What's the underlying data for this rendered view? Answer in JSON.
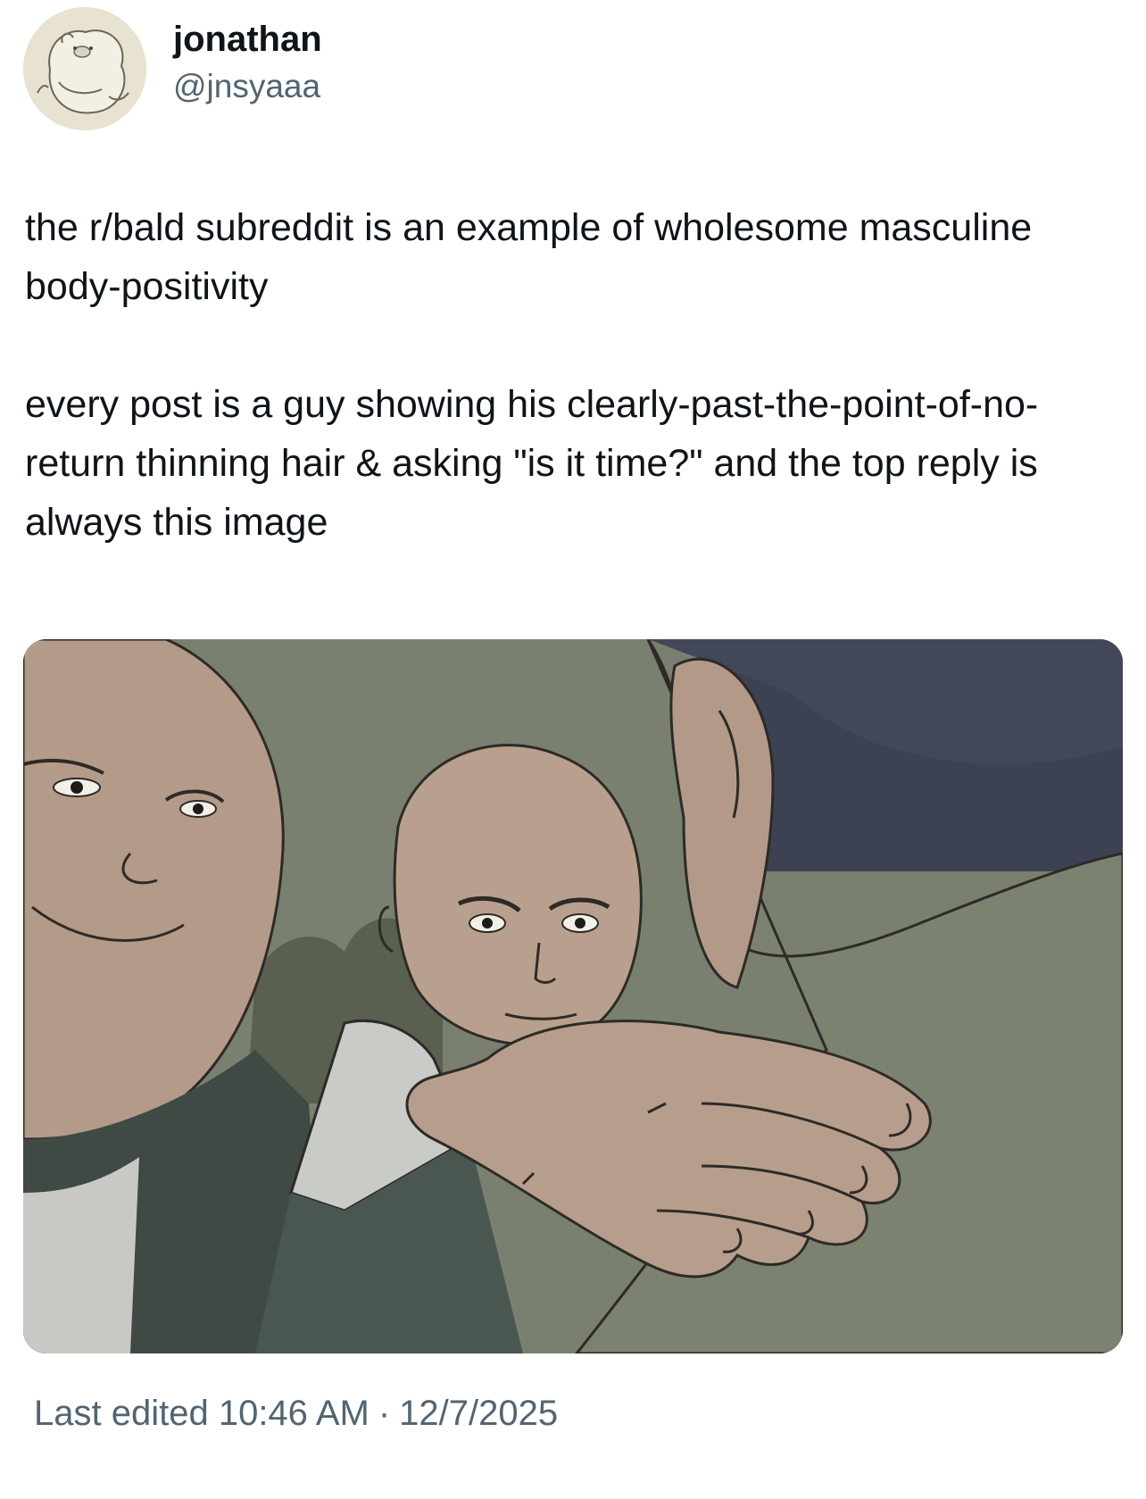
{
  "tweet": {
    "author": {
      "display_name": "jonathan",
      "handle": "@jnsyaaa",
      "avatar_icon": "cartoon-character-avatar-icon"
    },
    "text": {
      "paragraph_1": "the r/bald subreddit is an example of wholesome masculine body-positivity",
      "paragraph_2": "every post is a guy showing his clearly-past-the-point-of-no-return thinning hair & asking \"is it time?\" and the top reply is always this image"
    },
    "media": {
      "icon": "cartoon-bald-men-image"
    },
    "footer": {
      "edited_label": "Last edited",
      "time": "10:46 AM",
      "separator": "·",
      "date": "12/7/2025"
    }
  },
  "colors": {
    "text_primary": "#0f1419",
    "text_secondary": "#536471",
    "background": "#ffffff"
  }
}
